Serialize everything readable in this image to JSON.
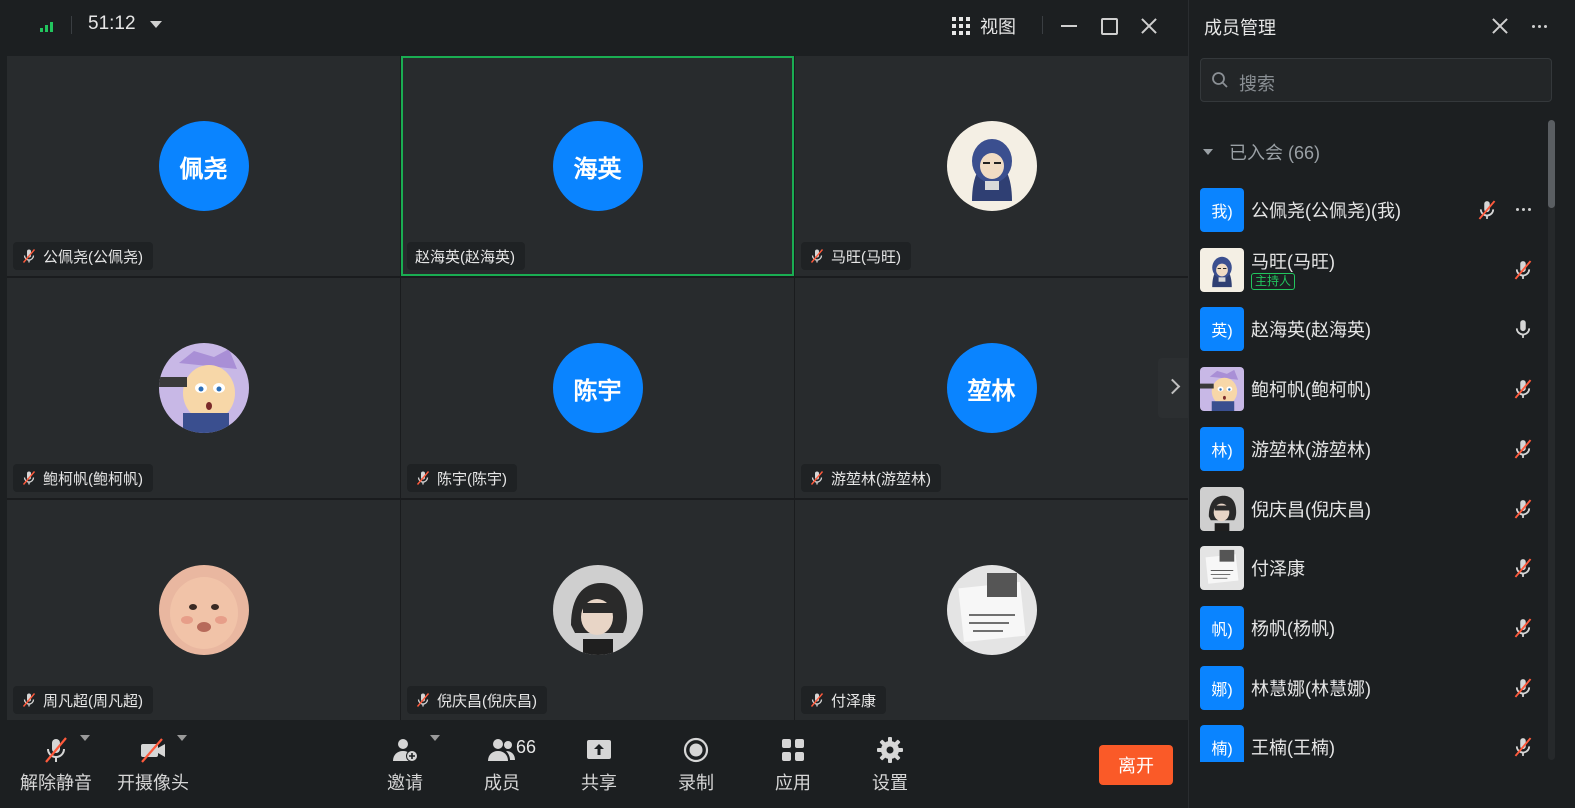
{
  "topbar": {
    "timer": "51:12",
    "view_label": "视图"
  },
  "tiles": [
    {
      "initials": "佩尧",
      "label": "公佩尧(公佩尧)",
      "muted": true,
      "avatar": "blue",
      "active": false
    },
    {
      "initials": "海英",
      "label": "赵海英(赵海英)",
      "muted": false,
      "avatar": "blue",
      "active": true
    },
    {
      "initials": "",
      "label": "马旺(马旺)",
      "muted": true,
      "avatar": "photo-hood",
      "active": false
    },
    {
      "initials": "",
      "label": "鲍柯帆(鲍柯帆)",
      "muted": true,
      "avatar": "photo-anime",
      "active": false
    },
    {
      "initials": "陈宇",
      "label": "陈宇(陈宇)",
      "muted": true,
      "avatar": "blue",
      "active": false
    },
    {
      "initials": "堃林",
      "label": "游堃林(游堃林)",
      "muted": true,
      "avatar": "blue",
      "active": false
    },
    {
      "initials": "",
      "label": "周凡超(周凡超)",
      "muted": true,
      "avatar": "photo-baby",
      "active": false
    },
    {
      "initials": "",
      "label": "倪庆昌(倪庆昌)",
      "muted": true,
      "avatar": "photo-person",
      "active": false
    },
    {
      "initials": "",
      "label": "付泽康",
      "muted": true,
      "avatar": "photo-paper",
      "active": false
    }
  ],
  "toolbar": {
    "unmute": "解除静音",
    "camera": "开摄像头",
    "invite": "邀请",
    "members": "成员",
    "members_count": "66",
    "share": "共享",
    "record": "录制",
    "apps": "应用",
    "settings": "设置",
    "leave": "离开"
  },
  "panel": {
    "title": "成员管理",
    "search_placeholder": "搜索",
    "group_label": "已入会 (66)",
    "host_badge": "主持人",
    "members": [
      {
        "avatar_text": "我)",
        "name": "公佩尧(公佩尧)(我)",
        "avatar": "blue",
        "mic": "muted",
        "me": true
      },
      {
        "avatar_text": "",
        "name": "马旺(马旺)",
        "avatar": "photo-hood",
        "mic": "muted",
        "host": true
      },
      {
        "avatar_text": "英)",
        "name": "赵海英(赵海英)",
        "avatar": "blue",
        "mic": "on"
      },
      {
        "avatar_text": "",
        "name": "鲍柯帆(鲍柯帆)",
        "avatar": "photo-anime",
        "mic": "muted"
      },
      {
        "avatar_text": "林)",
        "name": "游堃林(游堃林)",
        "avatar": "blue",
        "mic": "muted"
      },
      {
        "avatar_text": "",
        "name": "倪庆昌(倪庆昌)",
        "avatar": "photo-person",
        "mic": "muted"
      },
      {
        "avatar_text": "",
        "name": "付泽康",
        "avatar": "photo-paper",
        "mic": "muted"
      },
      {
        "avatar_text": "帆)",
        "name": "杨帆(杨帆)",
        "avatar": "blue",
        "mic": "muted"
      },
      {
        "avatar_text": "娜)",
        "name": "林慧娜(林慧娜)",
        "avatar": "blue",
        "mic": "muted"
      },
      {
        "avatar_text": "楠)",
        "name": "王楠(王楠)",
        "avatar": "blue",
        "mic": "muted"
      }
    ]
  },
  "colors": {
    "accent": "#0a84ff",
    "active_border": "#1aad52",
    "leave": "#fa5a28",
    "mute_slash": "#ff5a3c"
  }
}
